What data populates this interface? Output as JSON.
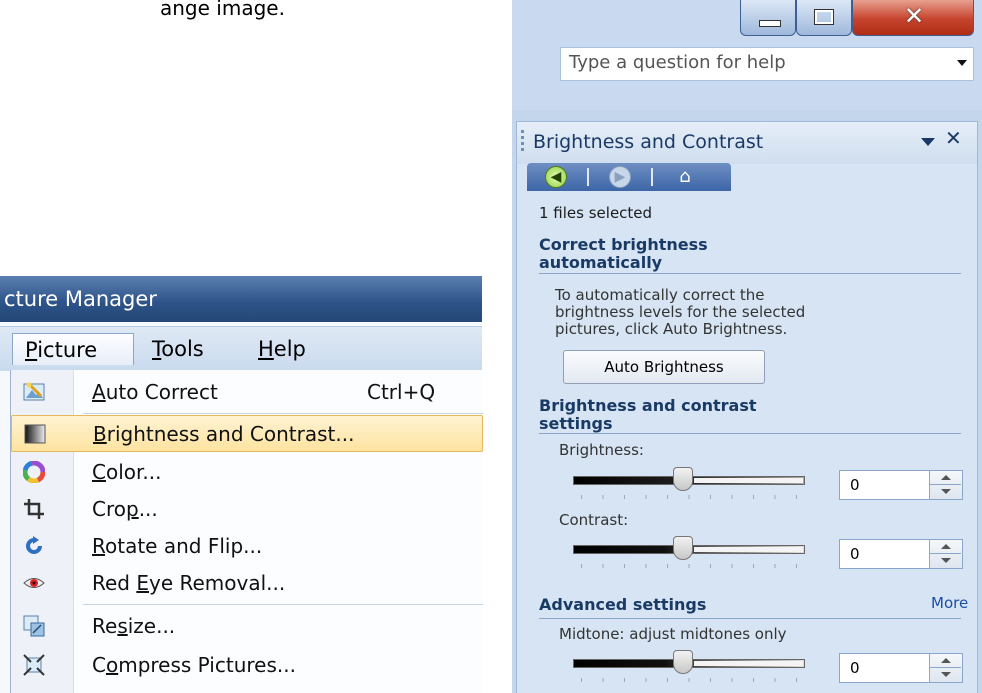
{
  "top_text": "ange image.",
  "menu": {
    "window_title": "cture Manager",
    "menubar": {
      "picture": "Picture",
      "picture_m": "P",
      "picture_r": "icture",
      "tools": "Tools",
      "tools_m": "T",
      "tools_r": "ools",
      "help": "Help",
      "help_m": "H",
      "help_r": "elp"
    },
    "items": [
      {
        "icon": "auto-correct-icon",
        "pre": "",
        "m": "A",
        "post": "uto Correct",
        "shortcut": "Ctrl+Q"
      },
      {
        "icon": "brightness-contrast-icon",
        "pre": "",
        "m": "B",
        "post": "rightness and Contrast...",
        "shortcut": ""
      },
      {
        "icon": "color-wheel-icon",
        "pre": "",
        "m": "C",
        "post": "olor...",
        "shortcut": ""
      },
      {
        "icon": "crop-icon",
        "pre": "Cro",
        "m": "p",
        "post": "...",
        "shortcut": ""
      },
      {
        "icon": "rotate-flip-icon",
        "pre": "",
        "m": "R",
        "post": "otate and Flip...",
        "shortcut": ""
      },
      {
        "icon": "red-eye-icon",
        "pre": "Red ",
        "m": "E",
        "post": "ye Removal...",
        "shortcut": ""
      },
      {
        "icon": "resize-icon",
        "pre": "Re",
        "m": "s",
        "post": "ize...",
        "shortcut": ""
      },
      {
        "icon": "compress-pictures-icon",
        "pre": "C",
        "m": "o",
        "post": "mpress Pictures...",
        "shortcut": ""
      }
    ]
  },
  "pane": {
    "help_placeholder": "Type a question for help",
    "title": "Brightness and Contrast",
    "files_selected": "1 files selected",
    "section_auto": {
      "line1": "Correct brightness",
      "line2": "automatically"
    },
    "desc": {
      "line1": "To automatically correct the",
      "line2": "brightness levels for the selected",
      "line3": "pictures, click Auto Brightness."
    },
    "auto_button": "Auto Brightness",
    "section_settings": {
      "line1": "Brightness and contrast",
      "line2": "settings"
    },
    "brightness": {
      "label": "Brightness:",
      "value": "0"
    },
    "contrast": {
      "label": "Contrast:",
      "value": "0"
    },
    "advanced": {
      "title": "Advanced settings",
      "more": "More"
    },
    "midtone": {
      "label": "Midtone: adjust midtones only",
      "value": "0"
    }
  }
}
